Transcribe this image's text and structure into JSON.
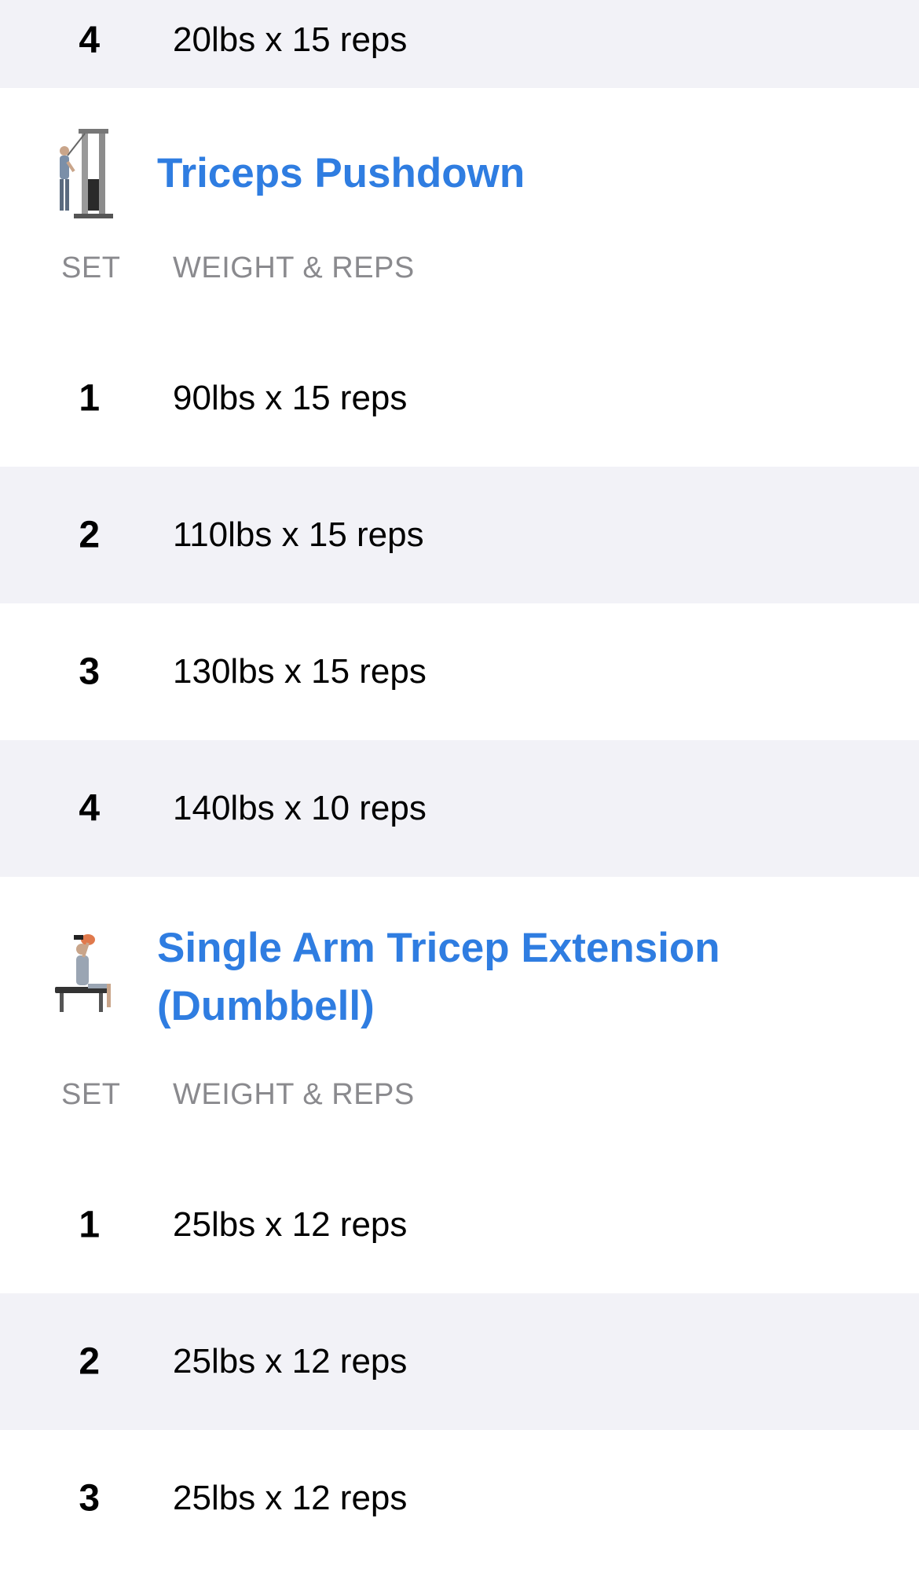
{
  "prev_exercise": {
    "last_set": {
      "set": "4",
      "value": "20lbs x 15 reps"
    }
  },
  "exercises": [
    {
      "name": "Triceps Pushdown",
      "thumbnail_icon": "cable-machine-exercise-icon",
      "col_set": "SET",
      "col_weight": "WEIGHT & REPS",
      "sets": [
        {
          "set": "1",
          "value": "90lbs x 15 reps"
        },
        {
          "set": "2",
          "value": "110lbs x 15 reps"
        },
        {
          "set": "3",
          "value": "130lbs x 15 reps"
        },
        {
          "set": "4",
          "value": "140lbs x 10 reps"
        }
      ]
    },
    {
      "name": "Single Arm Tricep Extension (Dumbbell)",
      "thumbnail_icon": "bench-dumbbell-exercise-icon",
      "col_set": "SET",
      "col_weight": "WEIGHT & REPS",
      "sets": [
        {
          "set": "1",
          "value": "25lbs x 12 reps"
        },
        {
          "set": "2",
          "value": "25lbs x 12 reps"
        },
        {
          "set": "3",
          "value": "25lbs x 12 reps"
        }
      ]
    }
  ],
  "colors": {
    "accent": "#2f7de1",
    "row_shade": "#f2f2f7",
    "header_gray": "#8a8a8e"
  }
}
